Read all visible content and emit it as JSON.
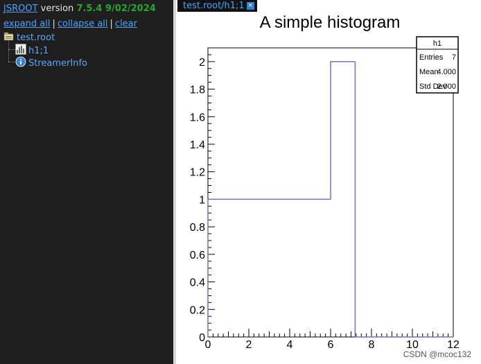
{
  "header": {
    "app_link": "JSROOT",
    "version_label": "version",
    "version": "7.5.4 9/02/2024",
    "expand_all": "expand all",
    "collapse_all": "collapse all",
    "clear": "clear",
    "separator": "|"
  },
  "tree": {
    "root_file": "test.root",
    "items": [
      {
        "label": "h1;1",
        "icon": "histogram-icon"
      },
      {
        "label": "StreamerInfo",
        "icon": "info-icon"
      }
    ]
  },
  "tab": {
    "label": "test.root/h1;1",
    "close_symbol": "×"
  },
  "stats": {
    "name": "h1",
    "rows": [
      {
        "label": "Entries",
        "value": "7"
      },
      {
        "label": "Mean",
        "value": "4.000"
      },
      {
        "label": "Std Dev",
        "value": "2.000"
      }
    ]
  },
  "chart_data": {
    "type": "histogram",
    "title": "A simple histogram",
    "xlabel": "",
    "ylabel": "",
    "xlim": [
      0,
      12
    ],
    "ylim": [
      0,
      2.1
    ],
    "x_ticks": [
      0,
      2,
      4,
      6,
      8,
      10,
      12
    ],
    "y_ticks": [
      0,
      0.2,
      0.4,
      0.6,
      0.8,
      1,
      1.2,
      1.4,
      1.6,
      1.8,
      2
    ],
    "y_tick_labels": [
      "0",
      "0.2",
      "0.4",
      "0.6",
      "0.8",
      "1",
      "1.2",
      "1.4",
      "1.6",
      "1.8",
      "2"
    ],
    "bins": [
      {
        "x0": 0,
        "x1": 6,
        "value": 1
      },
      {
        "x0": 6,
        "x1": 7.2,
        "value": 2
      },
      {
        "x0": 7.2,
        "x1": 12,
        "value": 0
      }
    ],
    "line_color": "#7070c0"
  },
  "watermark": "CSDN @mcoc132"
}
